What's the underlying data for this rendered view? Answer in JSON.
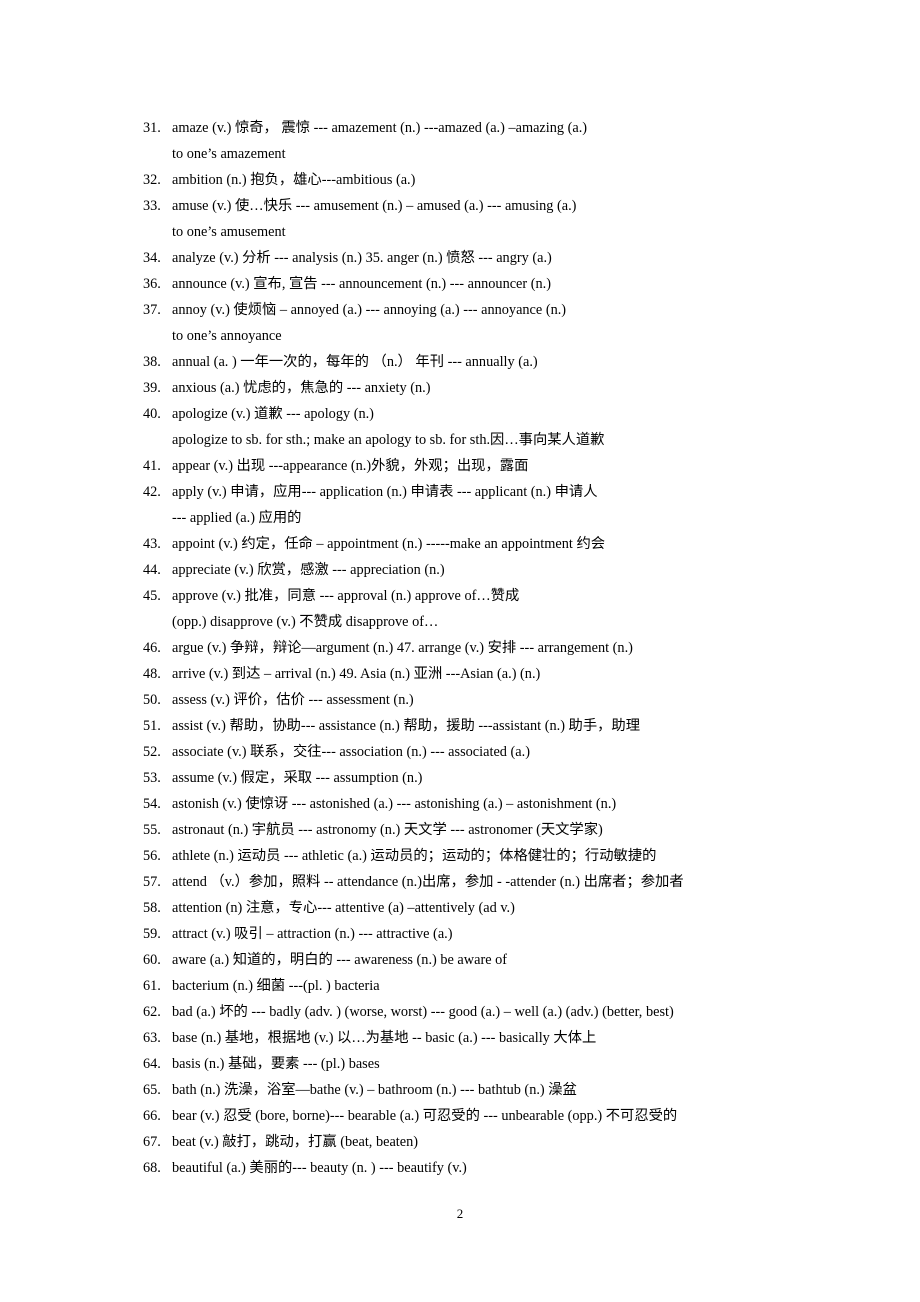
{
  "document": {
    "page_number": "2",
    "entries": [
      {
        "number": "31.",
        "lines": [
          "amaze (v.)  惊奇，  震惊  --- amazement (n.) ---amazed (a.) –amazing (a.)",
          "to one’s amazement"
        ]
      },
      {
        "number": "32.",
        "lines": [
          "ambition (n.)  抱负，雄心---ambitious (a.)"
        ]
      },
      {
        "number": "33.",
        "lines": [
          "amuse (v.)  使…快乐  --- amusement (n.) – amused (a.) --- amusing (a.)",
          "to one’s amusement"
        ]
      },
      {
        "number": "34.",
        "lines": [
          "analyze (v.)  分析  --- analysis (n.)              35.   anger (n.)  愤怒  --- angry    (a.)"
        ]
      },
      {
        "number": "36.",
        "lines": [
          "announce (v.)  宣布, 宣告  --- announcement (n.) --- announcer (n.)"
        ]
      },
      {
        "number": "37.",
        "lines": [
          "annoy (v.)  使烦恼  – annoyed (a.) --- annoying (a.) --- annoyance (n.)",
          "to one’s annoyance"
        ]
      },
      {
        "number": "38.",
        "lines": [
          "annual (a. )  一年一次的，每年的  （n.）  年刊  --- annually (a.)"
        ]
      },
      {
        "number": "39.",
        "lines": [
          "anxious (a.)  忧虑的，焦急的  --- anxiety (n.)"
        ]
      },
      {
        "number": "40.",
        "lines": [
          "apologize (v.)  道歉  --- apology (n.)",
          "apologize to sb. for sth.;   make an apology to sb. for sth.因…事向某人道歉"
        ]
      },
      {
        "number": "41.",
        "lines": [
          "appear (v.)  出现    ---appearance (n.)外貌，外观；出现，露面"
        ]
      },
      {
        "number": "42.",
        "lines": [
          "apply (v.)  申请，应用--- application (n.)  申请表 --- applicant (n.)  申请人",
          "--- applied (a.)  应用的"
        ]
      },
      {
        "number": "43.",
        "lines": [
          "appoint (v.)  约定，任命 – appointment (n.)   -----make an appointment  约会"
        ]
      },
      {
        "number": "44.",
        "lines": [
          "appreciate (v.)  欣赏，感激  --- appreciation (n.)"
        ]
      },
      {
        "number": "45.",
        "lines": [
          "approve (v.)  批准，同意  --- approval (n.)    approve of…赞成",
          "(opp.) disapprove (v.)  不赞成   disapprove of…"
        ]
      },
      {
        "number": "46.",
        "lines": [
          "argue (v.)  争辩，辩论—argument (n.)      47.  arrange (v.)  安排 --- arrangement (n.)"
        ]
      },
      {
        "number": "48.",
        "lines": [
          "arrive (v.)  到达 – arrival (n.)                49.   Asia (n.)  亚洲 ---Asian (a.) (n.)"
        ]
      },
      {
        "number": "50.",
        "lines": [
          "assess (v.)  评价，估价 --- assessment (n.)"
        ]
      },
      {
        "number": "51.",
        "lines": [
          "assist (v.)  帮助，协助--- assistance (n.)  帮助，援助    ---assistant (n.)  助手，助理"
        ]
      },
      {
        "number": "52.",
        "lines": [
          "associate (v.)  联系，交往--- association (n.)    --- associated (a.)"
        ]
      },
      {
        "number": "53.",
        "lines": [
          "assume (v.)  假定，采取 --- assumption (n.)"
        ]
      },
      {
        "number": "54.",
        "lines": [
          "astonish (v.)  使惊讶 --- astonished (a.) --- astonishing (a.) – astonishment (n.)"
        ]
      },
      {
        "number": "55.",
        "lines": [
          "astronaut (n.)  宇航员 --- astronomy (n.)  天文学 --- astronomer (天文学家)"
        ]
      },
      {
        "number": "56.",
        "lines": [
          "athlete (n.)  运动员 --- athletic (a.)  运动员的；运动的；体格健壮的；行动敏捷的"
        ]
      },
      {
        "number": "57.",
        "lines": [
          "attend  （v.）参加，照料 -- attendance (n.)出席，参加    - -attender (n.)  出席者；参加者"
        ]
      },
      {
        "number": "58.",
        "lines": [
          "attention (n)  注意，专心--- attentive (a) –attentively (ad v.)"
        ]
      },
      {
        "number": "59.",
        "lines": [
          "attract (v.)  吸引 – attraction (n.) --- attractive (a.)"
        ]
      },
      {
        "number": "60.",
        "lines": [
          "aware (a.)  知道的，明白的 --- awareness (n.)          be aware of"
        ]
      },
      {
        "number": "61.",
        "lines": [
          "bacterium (n.)  细菌 ---(pl. ) bacteria"
        ]
      },
      {
        "number": "62.",
        "lines": [
          "bad (a.)  坏的 --- badly (adv. ) (worse, worst)     --- good (a.) – well (a.) (adv.) (better, best)"
        ]
      },
      {
        "number": "63.",
        "lines": [
          "base (n.)  基地，根据地 (v.)  以…为基地 -- basic (a.) --- basically  大体上"
        ]
      },
      {
        "number": "64.",
        "lines": [
          "basis (n.)  基础，要素 --- (pl.) bases"
        ]
      },
      {
        "number": "65.",
        "lines": [
          "bath (n.)  洗澡，浴室—bathe (v.)     – bathroom (n.) --- bathtub (n.)  澡盆"
        ]
      },
      {
        "number": "66.",
        "lines": [
          "bear (v.)  忍受  (bore, borne)--- bearable (a.)  可忍受的 --- unbearable (opp.)  不可忍受的"
        ]
      },
      {
        "number": "67.",
        "lines": [
          "beat (v.)  敲打，跳动，打赢  (beat, beaten)"
        ]
      },
      {
        "number": "68.",
        "lines": [
          "beautiful (a.)  美丽的--- beauty (n. ) --- beautify (v.)"
        ]
      }
    ]
  }
}
